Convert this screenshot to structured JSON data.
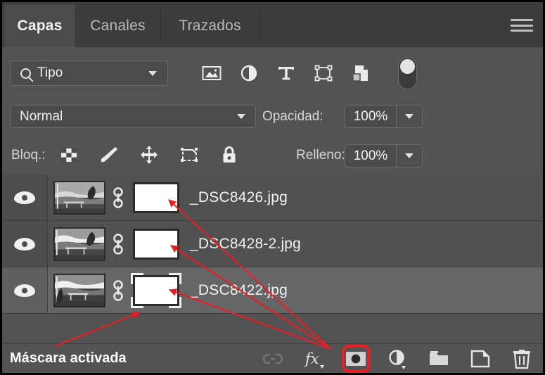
{
  "panel": {
    "tabs": [
      {
        "label": "Capas",
        "active": true
      },
      {
        "label": "Canales",
        "active": false
      },
      {
        "label": "Trazados",
        "active": false
      }
    ],
    "menu_icon": "hamburger-menu-icon"
  },
  "filter": {
    "search_icon": "search-icon",
    "type_label": "Tipo",
    "chevron_icon": "chevron-down-icon",
    "icons": [
      "pixel-layer-filter-icon",
      "adjustment-layer-filter-icon",
      "type-layer-filter-icon",
      "shape-layer-filter-icon",
      "smart-object-filter-icon"
    ],
    "toggle_icon": "filter-toggle-switch"
  },
  "blend": {
    "mode": "Normal",
    "mode_chevron_icon": "chevron-down-icon",
    "opacity_label": "Opacidad:",
    "opacity_value": "100%",
    "opacity_chevron_icon": "chevron-down-icon"
  },
  "lock": {
    "label": "Bloq.:",
    "icons": [
      "transparent-pixels-lock-icon",
      "image-pixels-lock-icon",
      "position-lock-icon",
      "artboard-nesting-lock-icon",
      "lock-all-icon"
    ],
    "fill_label": "Relleno:",
    "fill_value": "100%",
    "fill_chevron_icon": "chevron-down-icon"
  },
  "layers": [
    {
      "name": "_DSC8426.jpg",
      "visible": true,
      "selected": false,
      "mask_active": false,
      "visibility_icon": "eye-icon",
      "link_icon": "link-mask-icon",
      "thumbnail": "grayscale-landscape-thumbnail",
      "mask_thumbnail": "white-layer-mask-thumbnail"
    },
    {
      "name": "_DSC8428-2.jpg",
      "visible": true,
      "selected": false,
      "mask_active": false,
      "visibility_icon": "eye-icon",
      "link_icon": "link-mask-icon",
      "thumbnail": "grayscale-landscape-thumbnail",
      "mask_thumbnail": "white-layer-mask-thumbnail"
    },
    {
      "name": "_DSC8422.jpg",
      "visible": true,
      "selected": true,
      "mask_active": true,
      "visibility_icon": "eye-icon",
      "link_icon": "link-mask-icon",
      "thumbnail": "grayscale-landscape-thumbnail",
      "mask_thumbnail": "white-layer-mask-thumbnail"
    }
  ],
  "footer": {
    "annotation_text": "Máscara activada",
    "buttons": [
      {
        "name": "link-layers-button",
        "icon": "chain-link-icon",
        "disabled": true,
        "highlighted": false
      },
      {
        "name": "layer-style-button",
        "icon": "fx-icon",
        "disabled": false,
        "highlighted": false
      },
      {
        "name": "add-layer-mask-button",
        "icon": "layer-mask-icon",
        "disabled": false,
        "highlighted": true
      },
      {
        "name": "new-adjustment-layer-button",
        "icon": "half-circle-icon",
        "disabled": false,
        "highlighted": false
      },
      {
        "name": "new-group-button",
        "icon": "folder-icon",
        "disabled": false,
        "highlighted": false
      },
      {
        "name": "new-layer-button",
        "icon": "new-layer-icon",
        "disabled": false,
        "highlighted": false
      },
      {
        "name": "delete-layer-button",
        "icon": "trash-icon",
        "disabled": false,
        "highlighted": false
      }
    ]
  },
  "annotation": {
    "color": "#ee1c21",
    "arrow_count": 4
  }
}
